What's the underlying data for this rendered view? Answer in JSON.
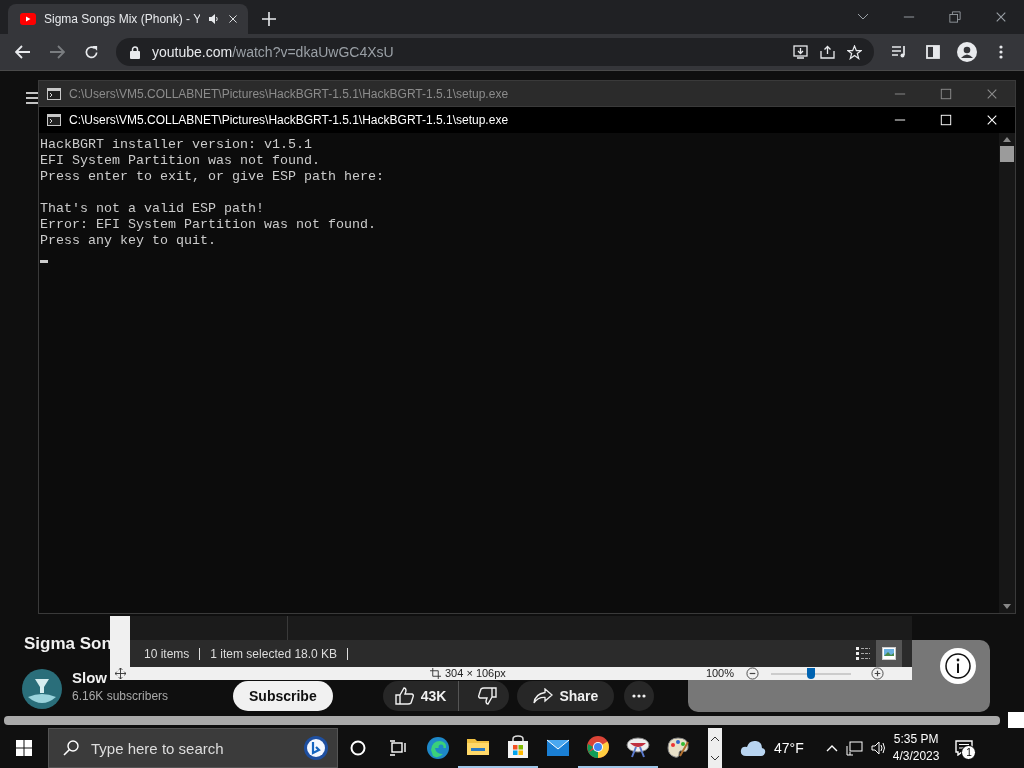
{
  "browser": {
    "tabs": [
      {
        "title": "Sigma Songs Mix (Phonk) - Y",
        "selected": true,
        "audible": true
      }
    ],
    "toolbar": {
      "forward_disabled": true
    },
    "address": {
      "host": "youtube.com",
      "path": "/watch?v=dkaUwGC4XsU"
    }
  },
  "video_page": {
    "title": "Sigma Son",
    "channel": "Slow",
    "subscribers": "6.16K subscribers",
    "subscribe_label": "Subscribe",
    "likes": "43K",
    "share_label": "Share"
  },
  "console_windows": [
    {
      "title": "C:\\Users\\VM5.COLLABNET\\Pictures\\HackBGRT-1.5.1\\HackBGRT-1.5.1\\setup.exe",
      "active": false
    },
    {
      "title": "C:\\Users\\VM5.COLLABNET\\Pictures\\HackBGRT-1.5.1\\HackBGRT-1.5.1\\setup.exe",
      "active": true,
      "cursor_visible": true,
      "blocks": [
        {
          "lines": [
            "HackBGRT installer version: v1.5.1",
            "EFI System Partition was not found.",
            "Press enter to exit, or give ESP path here:"
          ]
        },
        {
          "lines": [
            "That's not a valid ESP path!",
            "Error: EFI System Partition was not found.",
            "Press any key to quit."
          ]
        }
      ]
    }
  ],
  "photo_viewer": {
    "item_count": "10 items",
    "selection": "1 item selected  18.0 KB",
    "dimensions": "304 × 106px",
    "zoom": "100%",
    "zoom_slider": {
      "level": 0.5
    },
    "view_buttons": [
      {
        "kind": "details",
        "selected": false
      },
      {
        "kind": "preview",
        "selected": true
      }
    ]
  },
  "taskbar": {
    "search_placeholder": "Type here to search",
    "apps": [
      {
        "kind": "edge",
        "running": false
      },
      {
        "kind": "files",
        "running": true
      },
      {
        "kind": "store",
        "running": true
      },
      {
        "kind": "mail",
        "running": false
      },
      {
        "kind": "chrome",
        "running": true
      },
      {
        "kind": "tools",
        "running": true
      },
      {
        "kind": "paint",
        "running": false
      }
    ],
    "weather": "47°F",
    "time": "5:35 PM",
    "date": "4/3/2023",
    "notification_count": "1"
  }
}
